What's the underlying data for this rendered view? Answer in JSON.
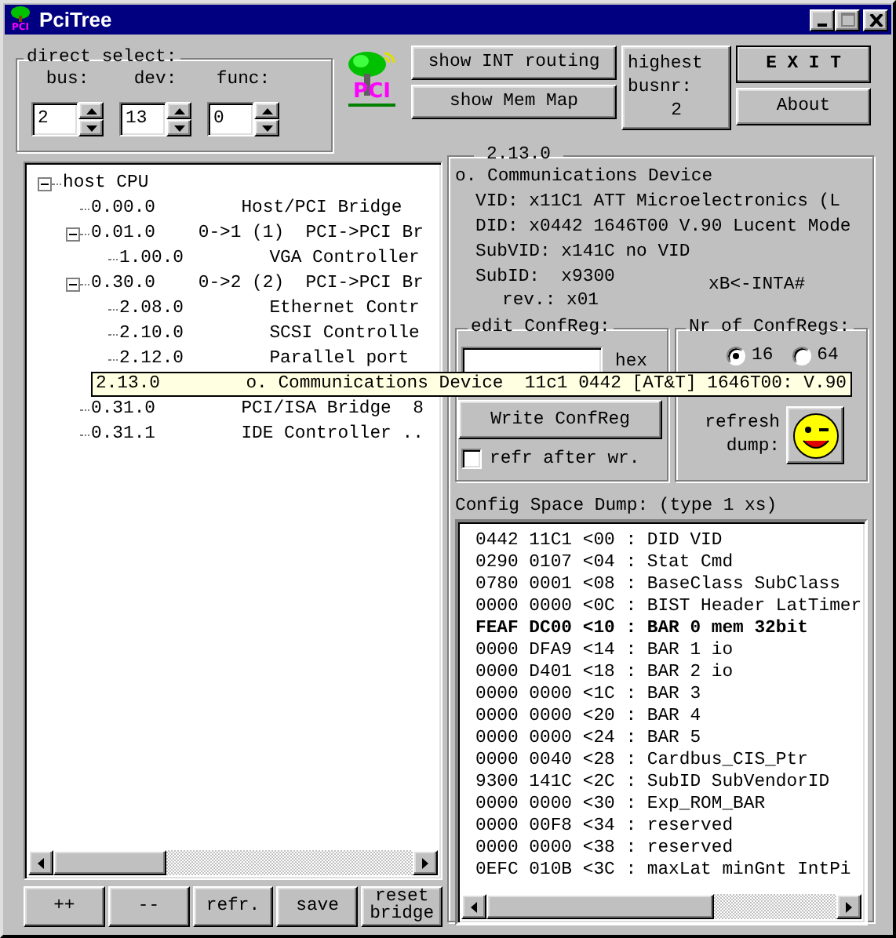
{
  "window": {
    "title": "PciTree",
    "icon_text": "PCI"
  },
  "direct_select": {
    "title": "direct select:",
    "fields": [
      {
        "label": "bus:",
        "value": "2"
      },
      {
        "label": "dev:",
        "value": "13"
      },
      {
        "label": "func:",
        "value": "0"
      }
    ]
  },
  "logo": {
    "text": "PCI"
  },
  "top_buttons": [
    "show INT routing",
    "show Mem Map"
  ],
  "highest_busnr": {
    "label": "highest busnr:",
    "value": "2"
  },
  "main_buttons": [
    "E X I T",
    "About"
  ],
  "tree": [
    {
      "text": "host CPU",
      "expanded": true,
      "children": [
        {
          "text": "0.00.0        Host/PCI Bridge"
        },
        {
          "text": "0.01.0    0->1 (1)  PCI->PCI Br",
          "expanded": true,
          "children": [
            {
              "text": "1.00.0        VGA Controller"
            }
          ]
        },
        {
          "text": "0.30.0    0->2 (2)  PCI->PCI Br",
          "expanded": true,
          "children": [
            {
              "text": "2.08.0        Ethernet Contr"
            },
            {
              "text": "2.10.0        SCSI Controlle"
            },
            {
              "text": "2.12.0        Parallel port"
            },
            {
              "tooltip": "2.13.0        o. Communications Device  11c1 0442 [AT&T] 1646T00: V.90"
            }
          ]
        },
        {
          "text": "0.31.0        PCI/ISA Bridge  8"
        },
        {
          "text": "0.31.1        IDE Controller .."
        }
      ]
    }
  ],
  "tree_buttons": [
    "++",
    "--",
    "refr.",
    "save",
    "reset bridge"
  ],
  "device": {
    "title": "2.13.0",
    "name": "o. Communications Device",
    "lines": [
      "VID: x11C1 ATT Microelectronics (L",
      "DID: x0442 1646T00 V.90 Lucent Mode",
      "SubVID: x141C no VID",
      "SubID:  x9300"
    ],
    "rev": "rev.: x01",
    "interrupt": "xB<-INTA#"
  },
  "edit_confreg": {
    "title": "edit ConfReg:",
    "unit": "hex",
    "button": "Write ConfReg",
    "refresh_after": {
      "label": "refr after wr.",
      "checked": false
    }
  },
  "nr_confregs": {
    "title": "Nr of ConfRegs:",
    "options": [
      {
        "label": "16",
        "selected": true
      },
      {
        "label": "64",
        "selected": false
      }
    ],
    "refresh_label": "refresh dump:"
  },
  "dump": {
    "title": "Config Space Dump: (type 1 xs)",
    "lines": [
      "0442 11C1 <00 : DID VID",
      "0290 0107 <04 : Stat Cmd",
      "0780 0001 <08 : BaseClass SubClass",
      "0000 0000 <0C : BIST Header LatTimer",
      "FEAF DC00 <10 : BAR 0 mem 32bit",
      "0000 DFA9 <14 : BAR 1 io",
      "0000 D401 <18 : BAR 2 io",
      "0000 0000 <1C : BAR 3",
      "0000 0000 <20 : BAR 4",
      "0000 0000 <24 : BAR 5",
      "0000 0040 <28 : Cardbus_CIS_Ptr",
      "9300 141C <2C : SubID SubVendorID",
      "0000 0000 <30 : Exp_ROM_BAR",
      "0000 00F8 <34 : reserved",
      "0000 0000 <38 : reserved",
      "0EFC 010B <3C : maxLat minGnt IntPi"
    ]
  }
}
